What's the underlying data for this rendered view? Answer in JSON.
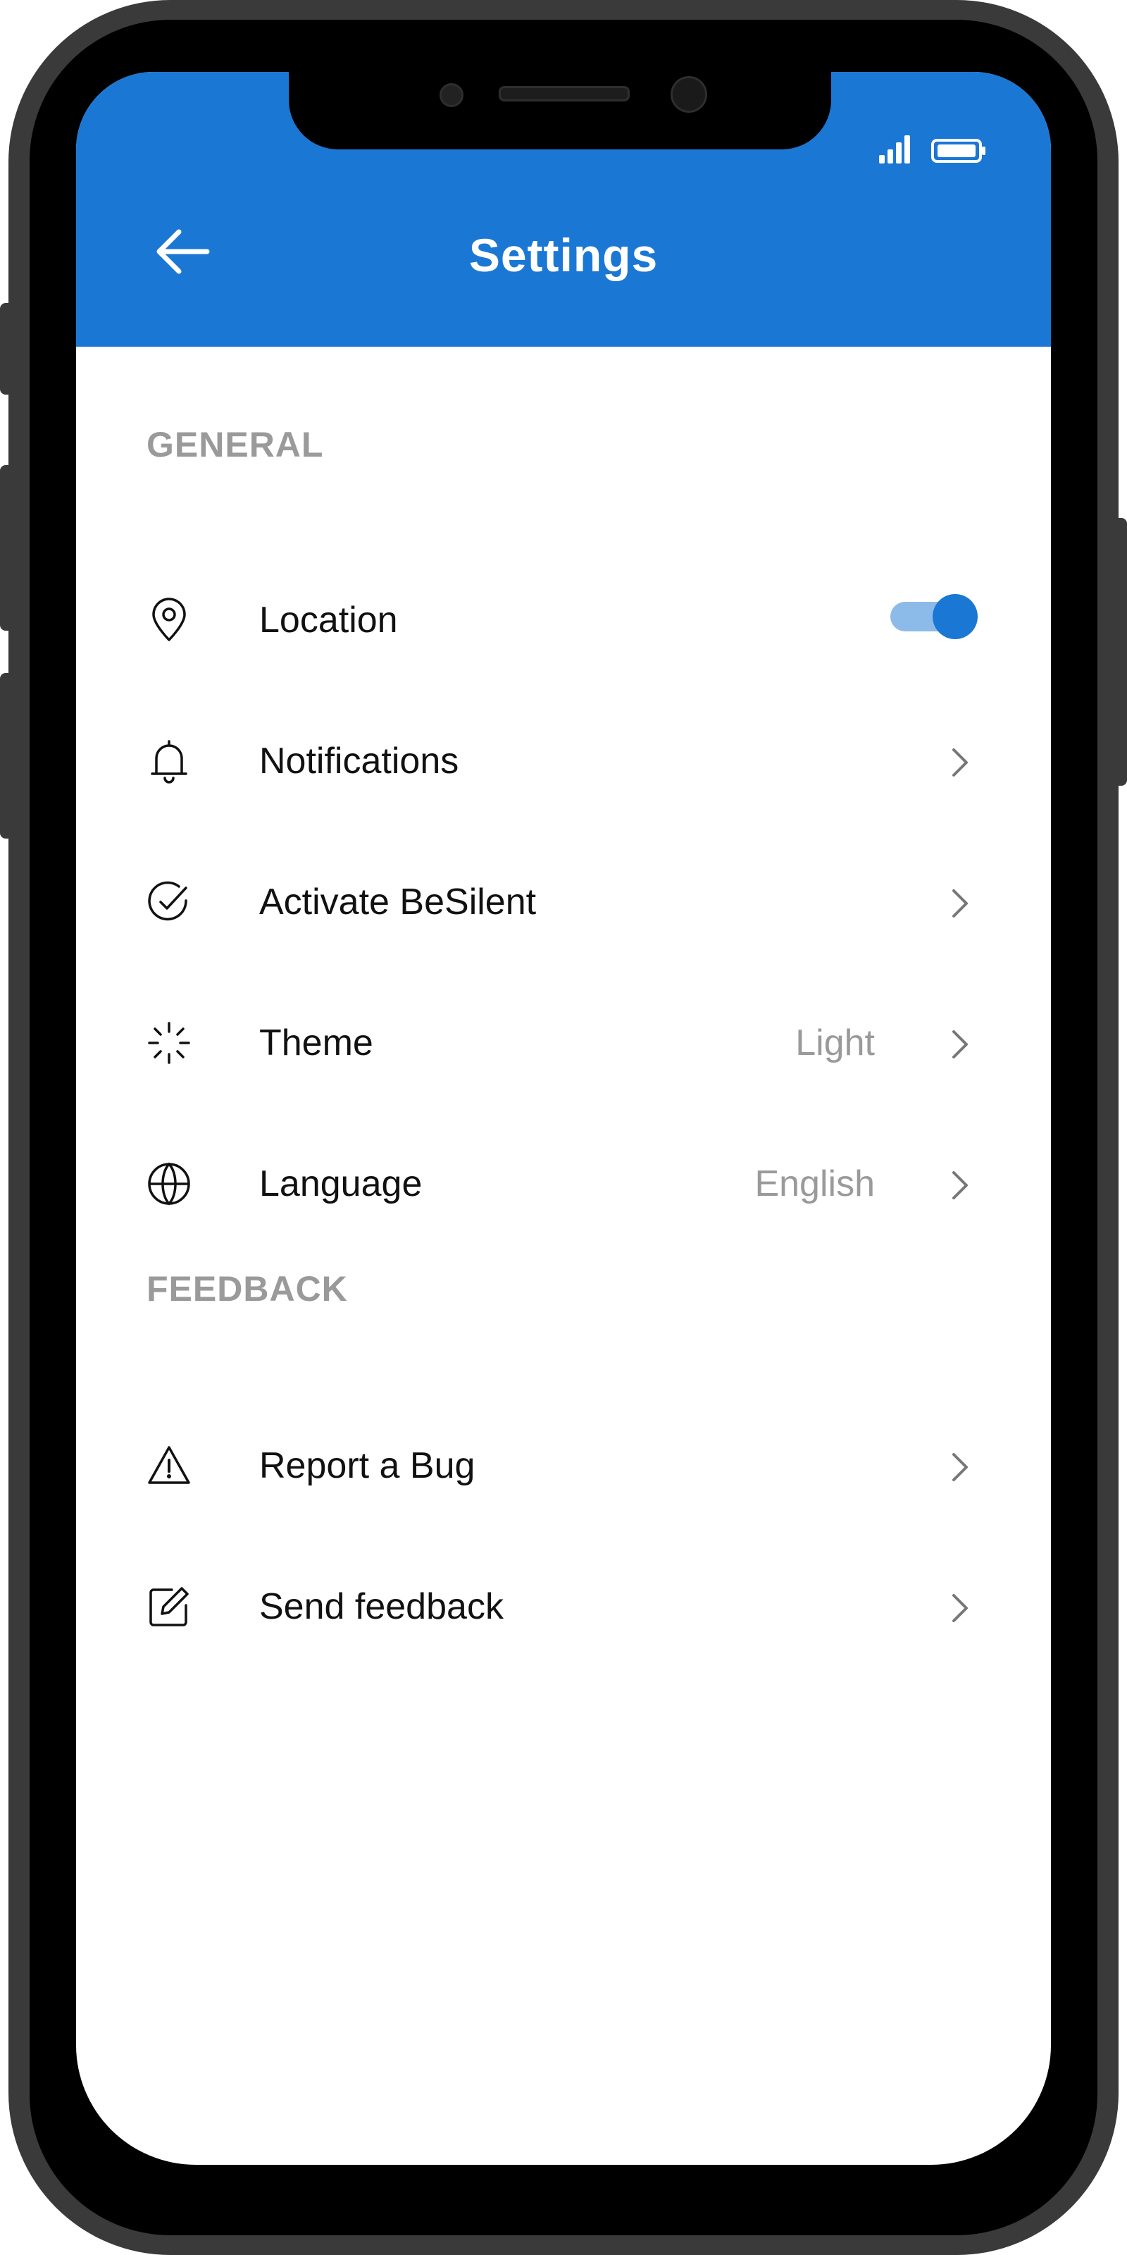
{
  "app_bar": {
    "title": "Settings",
    "background_color": "#1b77d4",
    "back_icon": "arrow-left-icon",
    "status_icons": [
      "signal-icon",
      "battery-icon"
    ]
  },
  "sections": {
    "general": {
      "title": "GENERAL",
      "items": {
        "location": {
          "label": "Location",
          "icon": "map-pin-icon",
          "toggle_on": true
        },
        "notifications": {
          "label": "Notifications",
          "icon": "bell-icon"
        },
        "besilent": {
          "label": "Activate BeSilent",
          "icon": "check-circle-icon"
        },
        "theme": {
          "label": "Theme",
          "value": "Light",
          "icon": "loader-icon"
        },
        "language": {
          "label": "Language",
          "value": "English",
          "icon": "globe-icon"
        }
      }
    },
    "feedback": {
      "title": "FEEDBACK",
      "items": {
        "report_bug": {
          "label": "Report a Bug",
          "icon": "warning-triangle-icon"
        },
        "send_feedback": {
          "label": "Send feedback",
          "icon": "edit-icon"
        }
      }
    }
  },
  "colors": {
    "accent": "#1b77d4",
    "toggle_track": "#8dbbe9",
    "secondary_text": "#9a9a9a"
  }
}
